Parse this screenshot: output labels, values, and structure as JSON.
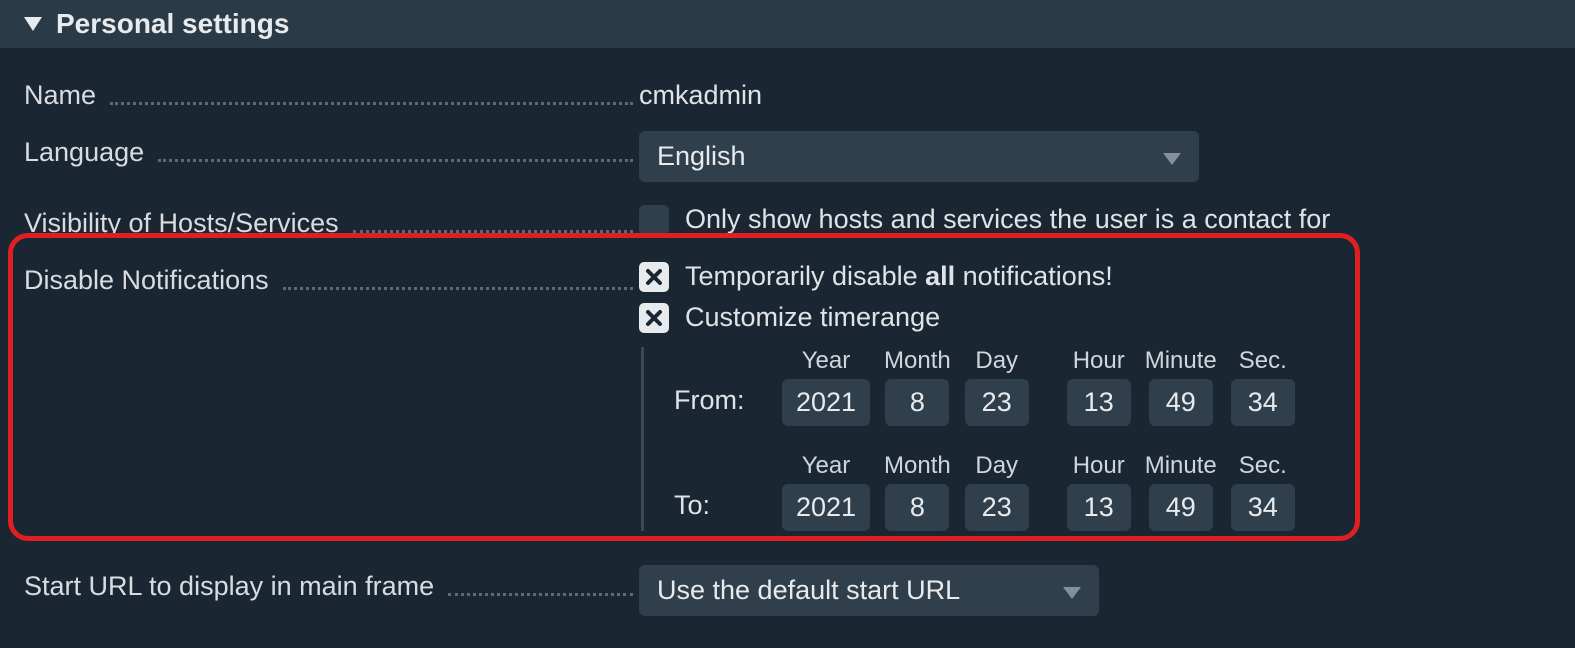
{
  "section": {
    "title": "Personal settings"
  },
  "rows": {
    "name": {
      "label": "Name",
      "value": "cmkadmin"
    },
    "language": {
      "label": "Language",
      "selected": "English"
    },
    "visibility": {
      "label": "Visibility of Hosts/Services",
      "checkbox_text": "Only show hosts and services the user is a contact for"
    },
    "disable_notifications": {
      "label": "Disable Notifications",
      "line1_pre": "Temporarily disable ",
      "line1_bold": "all",
      "line1_post": " notifications!",
      "line2": "Customize timerange"
    },
    "start_url": {
      "label": "Start URL to display in main frame",
      "selected": "Use the default start URL"
    }
  },
  "timerange": {
    "from_label": "From:",
    "to_label": "To:",
    "headers": {
      "year": "Year",
      "month": "Month",
      "day": "Day",
      "hour": "Hour",
      "minute": "Minute",
      "sec": "Sec."
    },
    "from": {
      "year": "2021",
      "month": "8",
      "day": "23",
      "hour": "13",
      "minute": "49",
      "sec": "34"
    },
    "to": {
      "year": "2021",
      "month": "8",
      "day": "23",
      "hour": "13",
      "minute": "49",
      "sec": "34"
    }
  }
}
